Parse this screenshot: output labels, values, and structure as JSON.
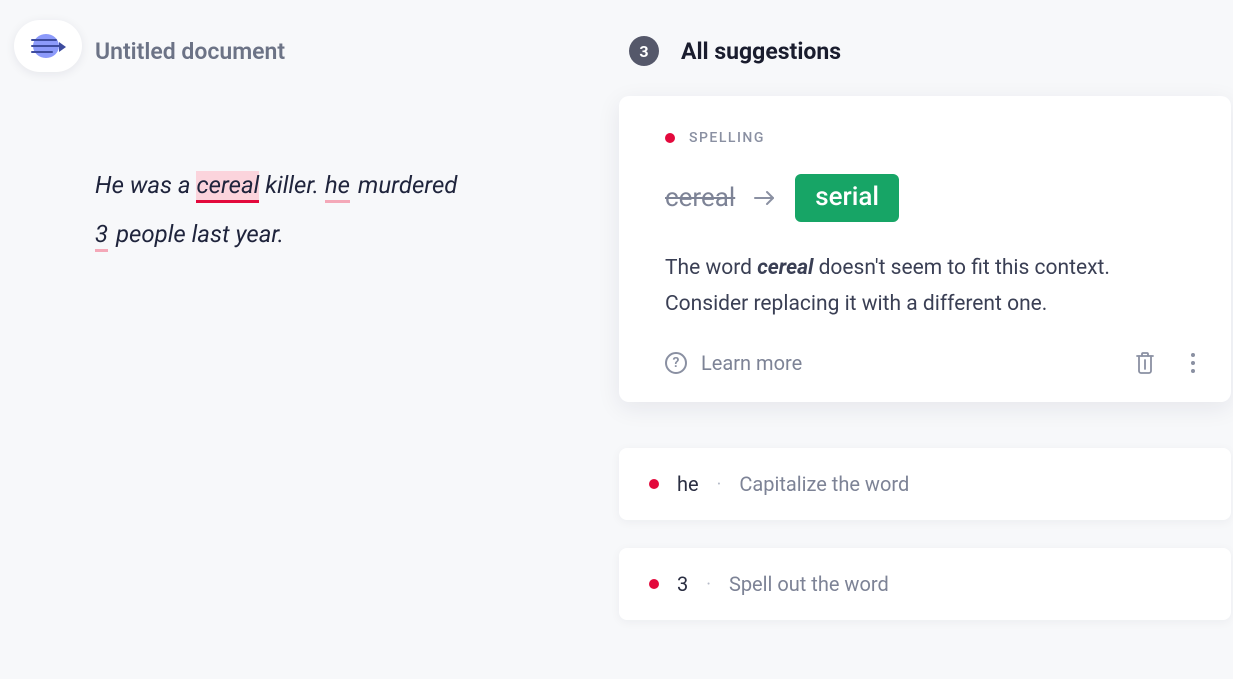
{
  "doc": {
    "title": "Untitled document"
  },
  "editor": {
    "text_segments": {
      "s0": "He was a ",
      "s1": "cereal",
      "s2": " killer. ",
      "s3": "he",
      "s4": " murdered ",
      "s5": "3",
      "s6": " people last year."
    }
  },
  "suggestions": {
    "count": "3",
    "title": "All suggestions",
    "active": {
      "category": "SPELLING",
      "original": "cereal",
      "replacement": "serial",
      "desc_pre": "The word ",
      "desc_word": "cereal",
      "desc_post": " doesn't seem to fit this context. Consider replacing it with a different one.",
      "learn_more": "Learn more"
    },
    "others": [
      {
        "word": "he",
        "hint": "Capitalize the word"
      },
      {
        "word": "3",
        "hint": "Spell out the word"
      }
    ]
  },
  "colors": {
    "error": "#e3093c",
    "accent": "#17a566"
  }
}
